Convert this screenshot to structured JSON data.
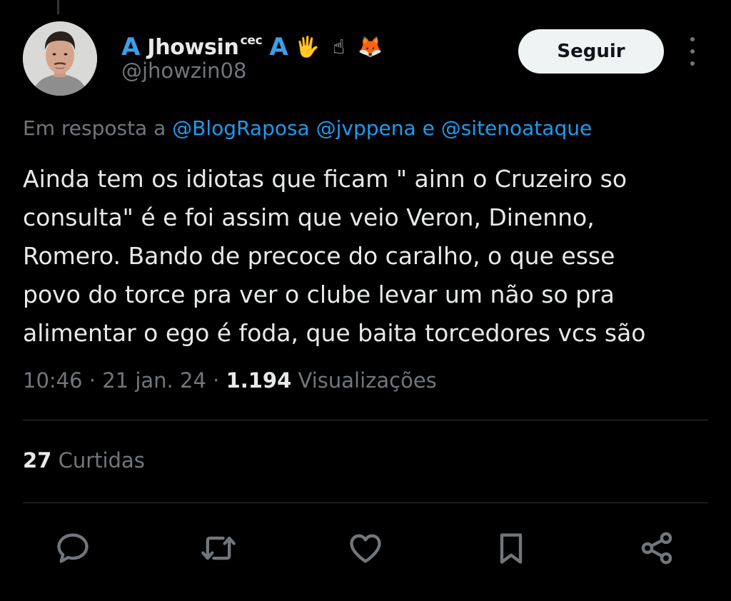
{
  "tweet": {
    "display_name": "Jhowsin",
    "name_superscript": "cec",
    "name_letter_left": "A",
    "name_letter_right": "A",
    "emojis": [
      "🖐",
      "☝",
      "🦊"
    ],
    "handle": "@jhowzin08",
    "follow_label": "Seguir",
    "reply_prefix": "Em resposta a",
    "reply_mentions": [
      "@BlogRaposa",
      "@jvppena",
      "@sitenoataque"
    ],
    "reply_conjunction": "e",
    "text_lines": [
      "Ainda tem os idiotas que ficam \" ainn o Cruzeiro so",
      "consulta\" é e foi assim que veio Veron, Dinenno,",
      "Romero. Bando de precoce do caralho, o que esse",
      "povo do torce pra ver o clube levar um não so pra",
      "alimentar o ego é foda, que baita torcedores vcs são"
    ],
    "time": "10:46",
    "date": "21 jan. 24",
    "separator": "·",
    "views_count": "1.194",
    "views_label": "Visualizações",
    "likes_count": "27",
    "likes_label": "Curtidas"
  },
  "actions": [
    {
      "icon": "reply-icon"
    },
    {
      "icon": "retweet-icon"
    },
    {
      "icon": "like-icon"
    },
    {
      "icon": "bookmark-icon"
    },
    {
      "icon": "share-icon"
    }
  ],
  "colors": {
    "background": "#000000",
    "text": "#e7e9ea",
    "secondary_text": "#71767b",
    "link": "#1d9bf0",
    "button_bg": "#eff3f4",
    "divider": "#2f3336"
  }
}
